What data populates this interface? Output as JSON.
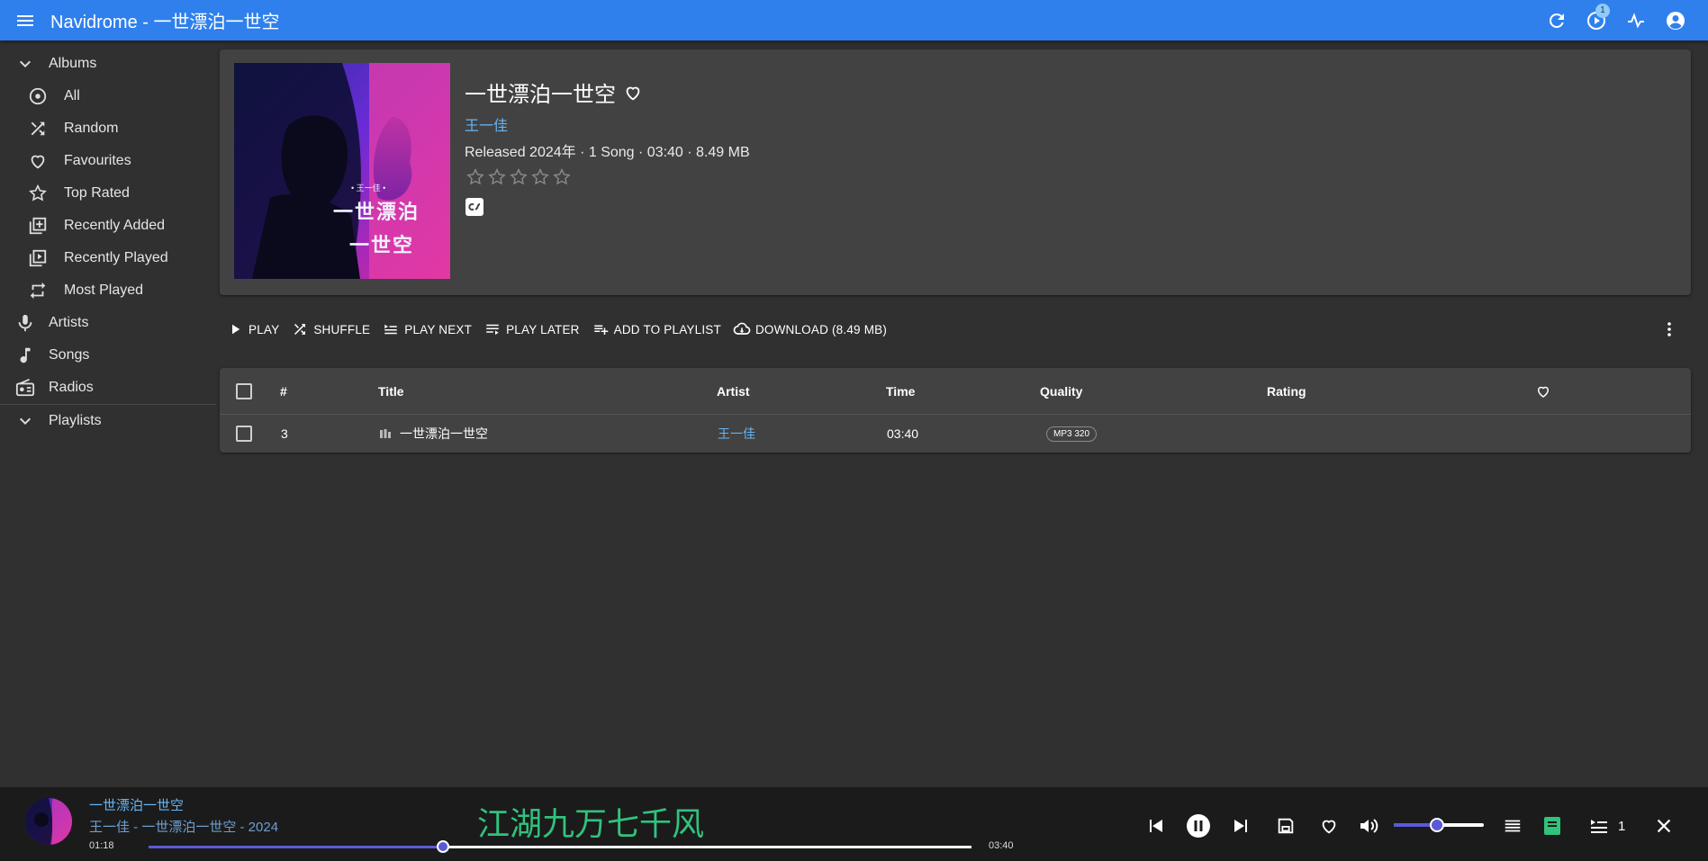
{
  "app": {
    "title": "Navidrome - 一世漂泊一世空",
    "queue_badge": "1"
  },
  "sidebar": {
    "albums_label": "Albums",
    "album_items": [
      {
        "label": "All",
        "icon": "album-icon"
      },
      {
        "label": "Random",
        "icon": "shuffle-icon"
      },
      {
        "label": "Favourites",
        "icon": "heart-icon"
      },
      {
        "label": "Top Rated",
        "icon": "star-icon"
      },
      {
        "label": "Recently Added",
        "icon": "library-add-icon"
      },
      {
        "label": "Recently Played",
        "icon": "video-library-icon"
      },
      {
        "label": "Most Played",
        "icon": "repeat-icon"
      }
    ],
    "artists_label": "Artists",
    "songs_label": "Songs",
    "radios_label": "Radios",
    "playlists_label": "Playlists"
  },
  "album": {
    "title": "一世漂泊一世空",
    "artist": "王一佳",
    "meta": "Released 2024年 · 1 Song · 03:40 · 8.49 MB",
    "rating": 0,
    "cover_text_small": "• 王一佳 •",
    "cover_text_line1": "一世漂泊",
    "cover_text_line2": "一世空"
  },
  "toolbar": {
    "play": "PLAY",
    "shuffle": "SHUFFLE",
    "play_next": "PLAY NEXT",
    "play_later": "PLAY LATER",
    "add_to_playlist": "ADD TO PLAYLIST",
    "download": "DOWNLOAD (8.49 MB)"
  },
  "table": {
    "columns": {
      "num": "#",
      "title": "Title",
      "artist": "Artist",
      "time": "Time",
      "quality": "Quality",
      "rating": "Rating"
    },
    "rows": [
      {
        "num": "3",
        "title": "一世漂泊一世空",
        "artist": "王一佳",
        "time": "03:40",
        "quality": "MP3 320"
      }
    ]
  },
  "player": {
    "title": "一世漂泊一世空",
    "subtitle": "王一佳 - 一世漂泊一世空 - 2024",
    "lyric": "江湖九万七千风",
    "current_time": "01:18",
    "total_time": "03:40",
    "progress": 0.358,
    "volume": 0.48,
    "queue_count": "1",
    "accent_color": "#5a5ad8",
    "lyric_color": "#31c27c"
  }
}
